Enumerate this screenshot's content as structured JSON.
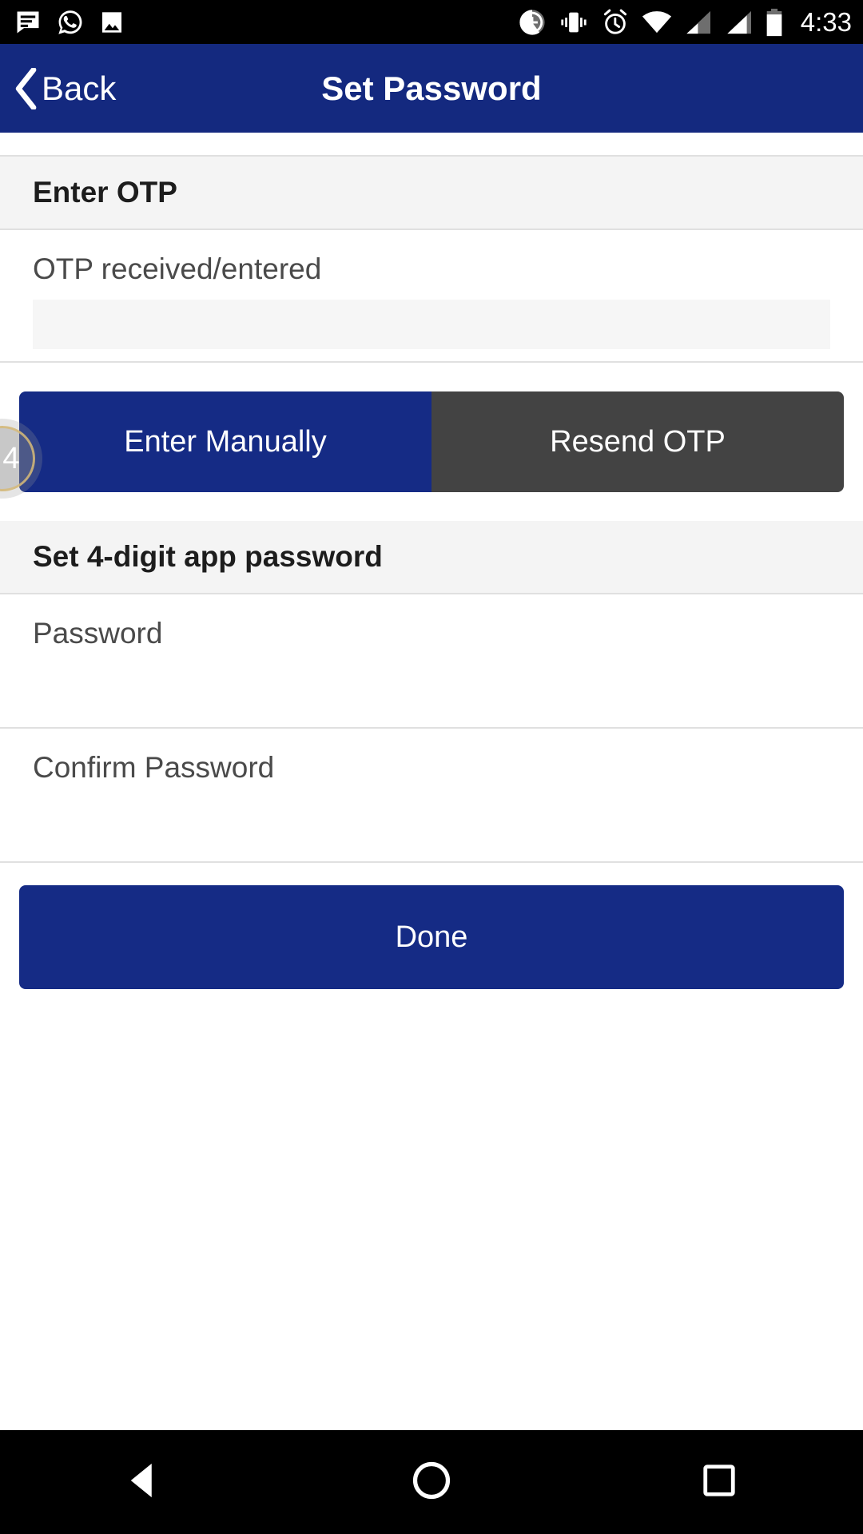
{
  "status_bar": {
    "time": "4:33",
    "left_icons": [
      {
        "name": "sms-message-icon"
      },
      {
        "name": "whatsapp-icon"
      },
      {
        "name": "gallery-image-icon"
      }
    ],
    "right_icons": [
      {
        "name": "data-saver-plus-icon"
      },
      {
        "name": "vibrate-mode-icon"
      },
      {
        "name": "alarm-clock-icon"
      },
      {
        "name": "wifi-signal-icon"
      },
      {
        "name": "cellular-signal-1-icon"
      },
      {
        "name": "cellular-signal-2-icon"
      },
      {
        "name": "battery-icon"
      }
    ]
  },
  "app_bar": {
    "back_label": "Back",
    "title": "Set Password",
    "background_color": "#14297f"
  },
  "otp_section": {
    "header": "Enter OTP",
    "field_label": "OTP received/entered",
    "field_value": "",
    "field_placeholder": ""
  },
  "touch_badge": {
    "number": "4"
  },
  "otp_actions": {
    "enter_manually_label": "Enter Manually",
    "enter_manually_color": "#152b85",
    "resend_otp_label": "Resend OTP",
    "resend_otp_color": "#434343"
  },
  "password_section": {
    "header": "Set 4-digit app password",
    "password_label": "Password",
    "password_value": "",
    "password_placeholder": "",
    "confirm_label": "Confirm Password",
    "confirm_value": "",
    "confirm_placeholder": ""
  },
  "footer": {
    "done_label": "Done",
    "done_color": "#152b85"
  },
  "nav_bar": {
    "back_icon": "triangle-back-icon",
    "home_icon": "circle-home-icon",
    "recents_icon": "square-recents-icon"
  }
}
